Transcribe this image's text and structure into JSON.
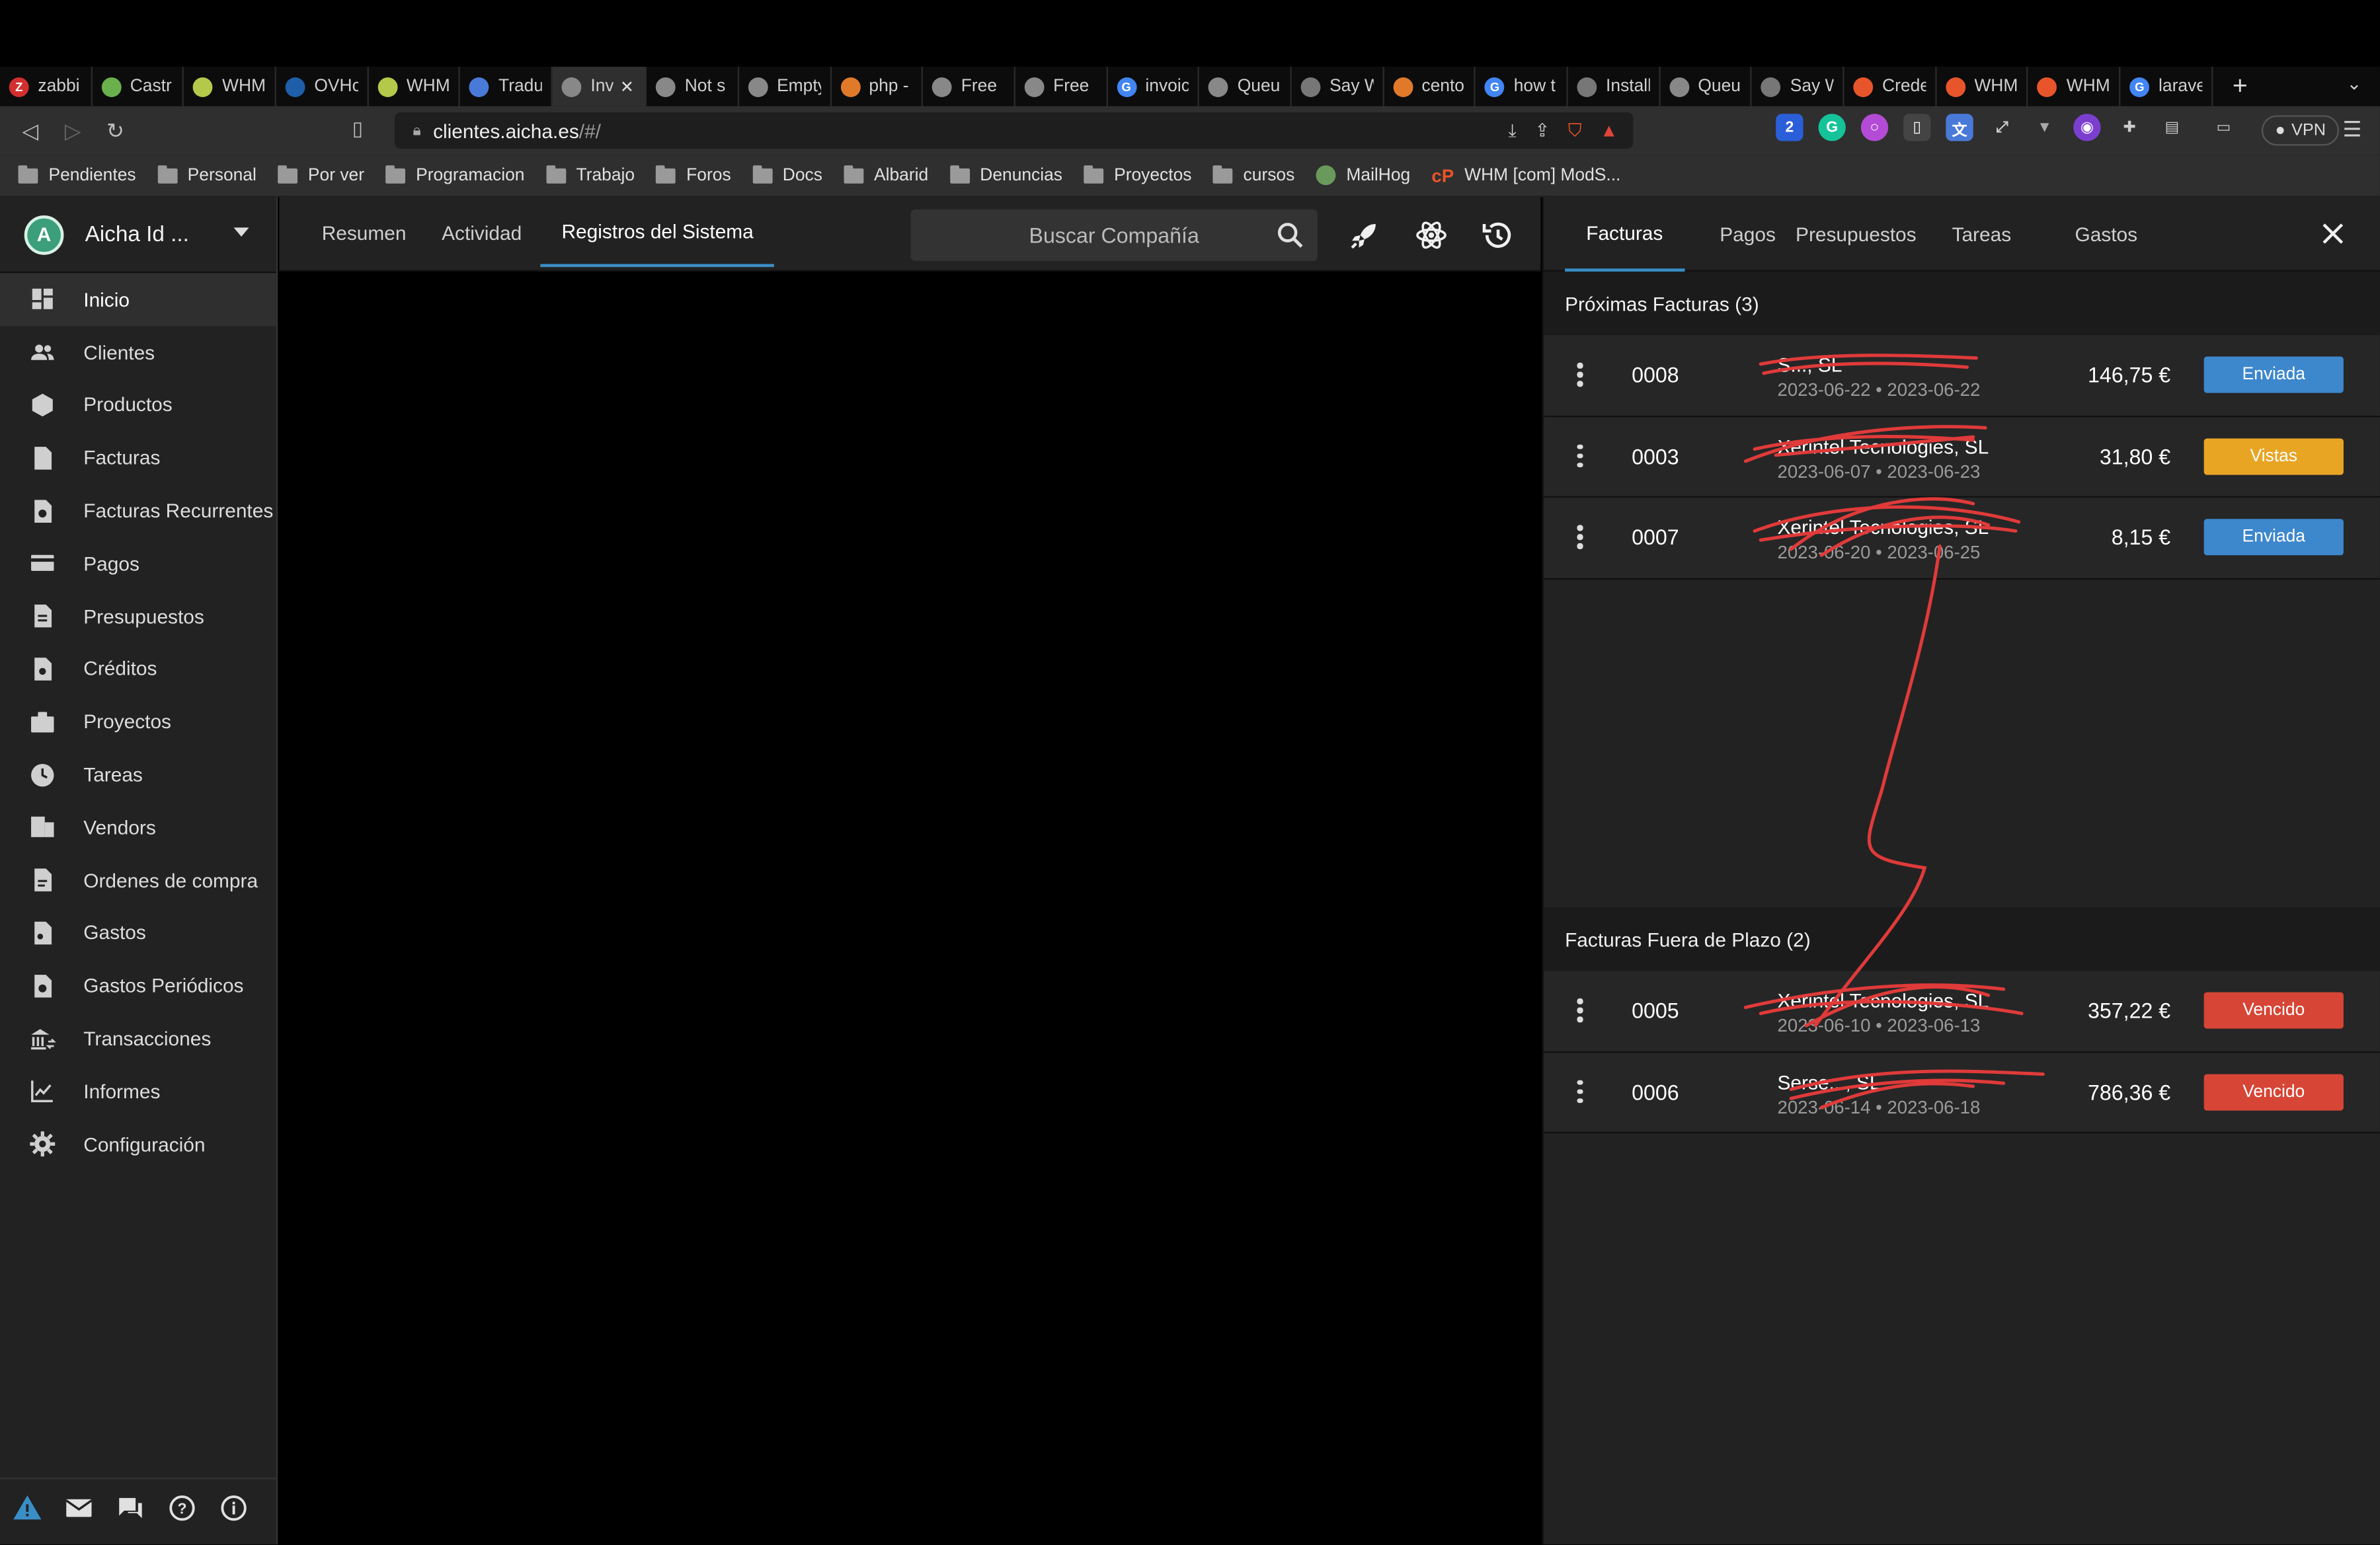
{
  "browser": {
    "tabs": [
      {
        "title": "zabbi",
        "color": "#d32f2f",
        "glyph": "Z"
      },
      {
        "title": "Castr",
        "color": "#6ab04c",
        "glyph": ""
      },
      {
        "title": "WHM",
        "color": "#b4c94a",
        "glyph": ""
      },
      {
        "title": "OVHc",
        "color": "#1f5ea8",
        "glyph": ""
      },
      {
        "title": "WHM",
        "color": "#b4c94a",
        "glyph": ""
      },
      {
        "title": "Tradu",
        "color": "#4a7ad8",
        "glyph": ""
      },
      {
        "title": "Inv",
        "color": "#888888",
        "glyph": "",
        "active": true
      },
      {
        "title": "Not s",
        "color": "#888888",
        "glyph": ""
      },
      {
        "title": "Empty",
        "color": "#888888",
        "glyph": ""
      },
      {
        "title": "php -",
        "color": "#e07a2a",
        "glyph": ""
      },
      {
        "title": "Free",
        "color": "#888888",
        "glyph": ""
      },
      {
        "title": "Free",
        "color": "#888888",
        "glyph": ""
      },
      {
        "title": "invoic",
        "color": "#4285f4",
        "glyph": "G"
      },
      {
        "title": "Queu",
        "color": "#888888",
        "glyph": ""
      },
      {
        "title": "Say W",
        "color": "#777777",
        "glyph": ""
      },
      {
        "title": "cento",
        "color": "#e07a2a",
        "glyph": ""
      },
      {
        "title": "how t",
        "color": "#4285f4",
        "glyph": "G"
      },
      {
        "title": "Install",
        "color": "#777777",
        "glyph": ""
      },
      {
        "title": "Queu",
        "color": "#888888",
        "glyph": ""
      },
      {
        "title": "Say W",
        "color": "#777777",
        "glyph": ""
      },
      {
        "title": "Crede",
        "color": "#e8552a",
        "glyph": ""
      },
      {
        "title": "WHM",
        "color": "#e8552a",
        "glyph": ""
      },
      {
        "title": "WHM",
        "color": "#e8552a",
        "glyph": ""
      },
      {
        "title": "larave",
        "color": "#4285f4",
        "glyph": "G"
      }
    ],
    "url_host": "clientes.aicha.es",
    "url_path": "/#/",
    "vpn_label": "VPN",
    "bookmarks": [
      {
        "label": "Pendientes",
        "type": "folder"
      },
      {
        "label": "Personal",
        "type": "folder"
      },
      {
        "label": "Por ver",
        "type": "folder"
      },
      {
        "label": "Programacion",
        "type": "folder"
      },
      {
        "label": "Trabajo",
        "type": "folder"
      },
      {
        "label": "Foros",
        "type": "folder"
      },
      {
        "label": "Docs",
        "type": "folder"
      },
      {
        "label": "Albarid",
        "type": "folder"
      },
      {
        "label": "Denuncias",
        "type": "folder"
      },
      {
        "label": "Proyectos",
        "type": "folder"
      },
      {
        "label": "cursos",
        "type": "folder"
      },
      {
        "label": "MailHog",
        "type": "mailhog"
      },
      {
        "label": "WHM [com] ModS...",
        "type": "cpanel"
      }
    ]
  },
  "app": {
    "company_name": "Aicha Id ...",
    "company_logo_letter": "A",
    "nav": [
      {
        "label": "Inicio",
        "icon": "dashboard-icon",
        "active": true
      },
      {
        "label": "Clientes",
        "icon": "clients-icon"
      },
      {
        "label": "Productos",
        "icon": "products-icon"
      },
      {
        "label": "Facturas",
        "icon": "invoices-icon"
      },
      {
        "label": "Facturas Recurrentes",
        "icon": "recurring-invoices-icon"
      },
      {
        "label": "Pagos",
        "icon": "payments-icon"
      },
      {
        "label": "Presupuestos",
        "icon": "quotes-icon"
      },
      {
        "label": "Créditos",
        "icon": "credits-icon"
      },
      {
        "label": "Proyectos",
        "icon": "projects-icon"
      },
      {
        "label": "Tareas",
        "icon": "tasks-icon"
      },
      {
        "label": "Vendors",
        "icon": "vendors-icon"
      },
      {
        "label": "Ordenes de compra",
        "icon": "purchase-orders-icon"
      },
      {
        "label": "Gastos",
        "icon": "expenses-icon"
      },
      {
        "label": "Gastos Periódicos",
        "icon": "recurring-expenses-icon"
      },
      {
        "label": "Transacciones",
        "icon": "transactions-icon"
      },
      {
        "label": "Informes",
        "icon": "reports-icon"
      },
      {
        "label": "Configuración",
        "icon": "settings-icon"
      }
    ],
    "top_tabs": [
      {
        "label": "Resumen"
      },
      {
        "label": "Actividad"
      },
      {
        "label": "Registros del Sistema",
        "active": true
      }
    ],
    "search_placeholder": "Buscar Compañía",
    "right_panel": {
      "tabs": [
        {
          "label": "Facturas",
          "active": true
        },
        {
          "label": "Pagos"
        },
        {
          "label": "Presupuestos"
        },
        {
          "label": "Tareas"
        },
        {
          "label": "Gastos"
        }
      ],
      "upcoming_title": "Próximas Facturas (3)",
      "upcoming": [
        {
          "number": "0008",
          "client": "S..., SL",
          "dates": "2023-06-22 • 2023-06-22",
          "amount": "146,75 €",
          "status": "Enviada",
          "status_color": "#3d87cc"
        },
        {
          "number": "0003",
          "client": "Xerintel Tecnologies, SL",
          "dates": "2023-06-07 • 2023-06-23",
          "amount": "31,80 €",
          "status": "Vistas",
          "status_color": "#e8a524"
        },
        {
          "number": "0007",
          "client": "Xerintel Tecnologies, SL",
          "dates": "2023-06-20 • 2023-06-25",
          "amount": "8,15 €",
          "status": "Enviada",
          "status_color": "#3d87cc"
        }
      ],
      "overdue_title": "Facturas Fuera de Plazo (2)",
      "overdue": [
        {
          "number": "0005",
          "client": "Xerintel Tecnologies, SL",
          "dates": "2023-06-10 • 2023-06-13",
          "amount": "357,22 €",
          "status": "Vencido",
          "status_color": "#d64535"
        },
        {
          "number": "0006",
          "client": "Serse..., SL",
          "dates": "2023-06-14 • 2023-06-18",
          "amount": "786,36 €",
          "status": "Vencido",
          "status_color": "#d64535"
        }
      ]
    }
  }
}
